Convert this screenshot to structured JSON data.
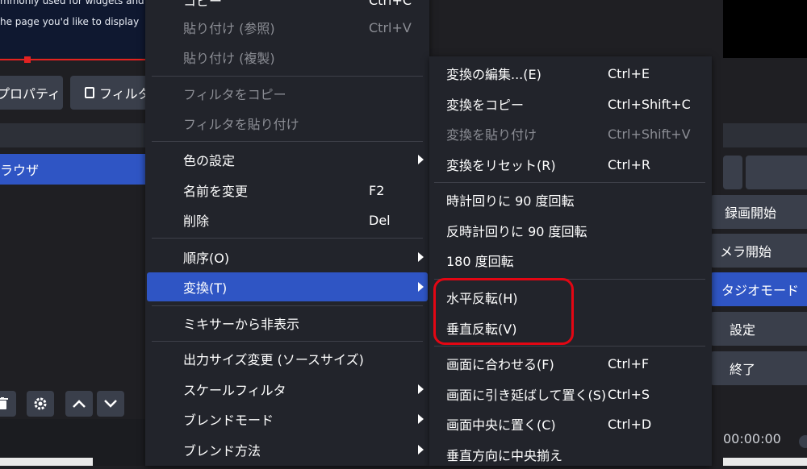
{
  "preview": {
    "line1": "mmonly used for widgets and a",
    "line2": "he page you'd like to display",
    "right_time": "00:00:00"
  },
  "toolbar": {
    "properties_label": "プロパティ",
    "filters_label": "フィルタ"
  },
  "sources": {
    "selected_label": "ラウザ"
  },
  "controls": {
    "start_recording": "録画開始",
    "start_virtual_camera": "メラ開始",
    "studio_mode": "タジオモード",
    "settings": "設定",
    "exit": "終了"
  },
  "context_menu": {
    "items": [
      {
        "label": "コピー",
        "shortcut": "Ctrl+C",
        "disabled": false
      },
      {
        "label": "貼り付け (参照)",
        "shortcut": "Ctrl+V",
        "disabled": true
      },
      {
        "label": "貼り付け (複製)",
        "shortcut": "",
        "disabled": true
      },
      {
        "label": "フィルタをコピー",
        "shortcut": "",
        "disabled": true
      },
      {
        "label": "フィルタを貼り付け",
        "shortcut": "",
        "disabled": true
      },
      {
        "label": "色の設定",
        "shortcut": "",
        "disabled": false
      },
      {
        "label": "名前を変更",
        "shortcut": "F2",
        "disabled": false
      },
      {
        "label": "削除",
        "shortcut": "Del",
        "disabled": false
      },
      {
        "label": "順序(O)",
        "shortcut": "",
        "disabled": false
      },
      {
        "label": "変換(T)",
        "shortcut": "",
        "disabled": false
      },
      {
        "label": "ミキサーから非表示",
        "shortcut": "",
        "disabled": false
      },
      {
        "label": "出力サイズ変更 (ソースサイズ)",
        "shortcut": "",
        "disabled": false
      },
      {
        "label": "スケールフィルタ",
        "shortcut": "",
        "disabled": false
      },
      {
        "label": "ブレンドモード",
        "shortcut": "",
        "disabled": false
      },
      {
        "label": "ブレンド方法",
        "shortcut": "",
        "disabled": false
      }
    ]
  },
  "transform_menu": {
    "items": [
      {
        "label": "変換の編集...(E)",
        "shortcut": "Ctrl+E",
        "disabled": false
      },
      {
        "label": "変換をコピー",
        "shortcut": "Ctrl+Shift+C",
        "disabled": false
      },
      {
        "label": "変換を貼り付け",
        "shortcut": "Ctrl+Shift+V",
        "disabled": true
      },
      {
        "label": "変換をリセット(R)",
        "shortcut": "Ctrl+R",
        "disabled": false
      },
      {
        "label": "時計回りに 90 度回転",
        "shortcut": "",
        "disabled": false
      },
      {
        "label": "反時計回りに 90 度回転",
        "shortcut": "",
        "disabled": false
      },
      {
        "label": "180 度回転",
        "shortcut": "",
        "disabled": false
      },
      {
        "label": "水平反転(H)",
        "shortcut": "",
        "disabled": false
      },
      {
        "label": "垂直反転(V)",
        "shortcut": "",
        "disabled": false
      },
      {
        "label": "画面に合わせる(F)",
        "shortcut": "Ctrl+F",
        "disabled": false
      },
      {
        "label": "画面に引き延ばして置く(S)",
        "shortcut": "Ctrl+S",
        "disabled": false
      },
      {
        "label": "画面中央に置く(C)",
        "shortcut": "Ctrl+D",
        "disabled": false
      },
      {
        "label": "垂直方向に中央揃え",
        "shortcut": "",
        "disabled": false
      }
    ]
  },
  "colors": {
    "menu_bg": "#22242b",
    "highlight": "#2f55c4",
    "annotation": "#e30613",
    "disabled_text": "#8b8d94"
  }
}
